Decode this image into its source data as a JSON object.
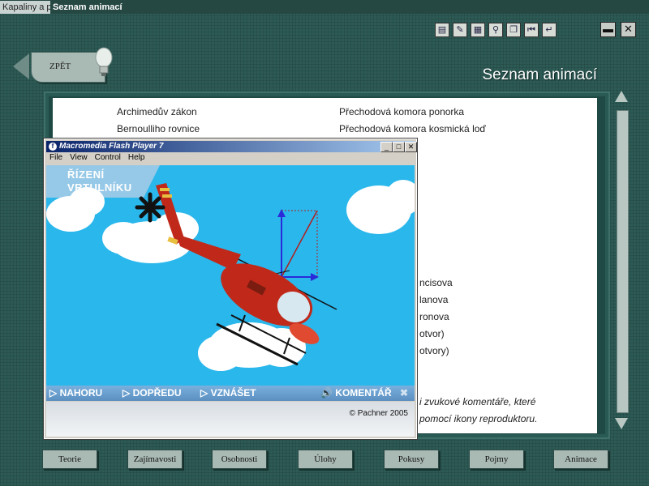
{
  "tabs": {
    "inactive": "Kapaliny a p",
    "active": "Seznam animací"
  },
  "toolbar": {
    "icons": [
      "folder-icon",
      "edit-icon",
      "notes-icon",
      "search-icon",
      "copy-icon",
      "rewind-icon",
      "return-icon"
    ],
    "minimize": "▬",
    "close": "✕"
  },
  "back_button": {
    "label": "ZPĚT"
  },
  "page_title": "Seznam animací",
  "content": {
    "left_column": [
      "Archimedův zákon",
      "Bernoulliho rovnice"
    ],
    "right_column": [
      "Přechodová komora ponorka",
      "Přechodová komora kosmická loď"
    ],
    "partial_items": [
      "ncisova",
      "lanova",
      "ronova",
      "otvor)",
      "otvory)"
    ],
    "note_line1": "i zvukové komentáře, které",
    "note_line2": "pomocí ikony reproduktoru."
  },
  "flash_window": {
    "title": "Macromedia Flash Player 7",
    "controls": [
      "_",
      "□",
      "✕"
    ],
    "menu": [
      "File",
      "View",
      "Control",
      "Help"
    ],
    "stage_title_line1": "ŘÍZENÍ",
    "stage_title_line2": "VRTULNÍKU",
    "nav": {
      "up": "NAHORU",
      "forward": "DOPŘEDU",
      "lift": "VZNÁŠET",
      "comment": "KOMENTÁŘ"
    },
    "copyright": "© Pachner 2005"
  },
  "bottom_nav": [
    "Teorie",
    "Zajímavosti",
    "Osobnosti",
    "Úlohy",
    "Pokusy",
    "Pojmy",
    "Animace"
  ],
  "colors": {
    "background": "#2d5a55",
    "stage_sky": "#2ab7ec",
    "helicopter": "#c0291a",
    "vector": "#2a2ad8"
  }
}
